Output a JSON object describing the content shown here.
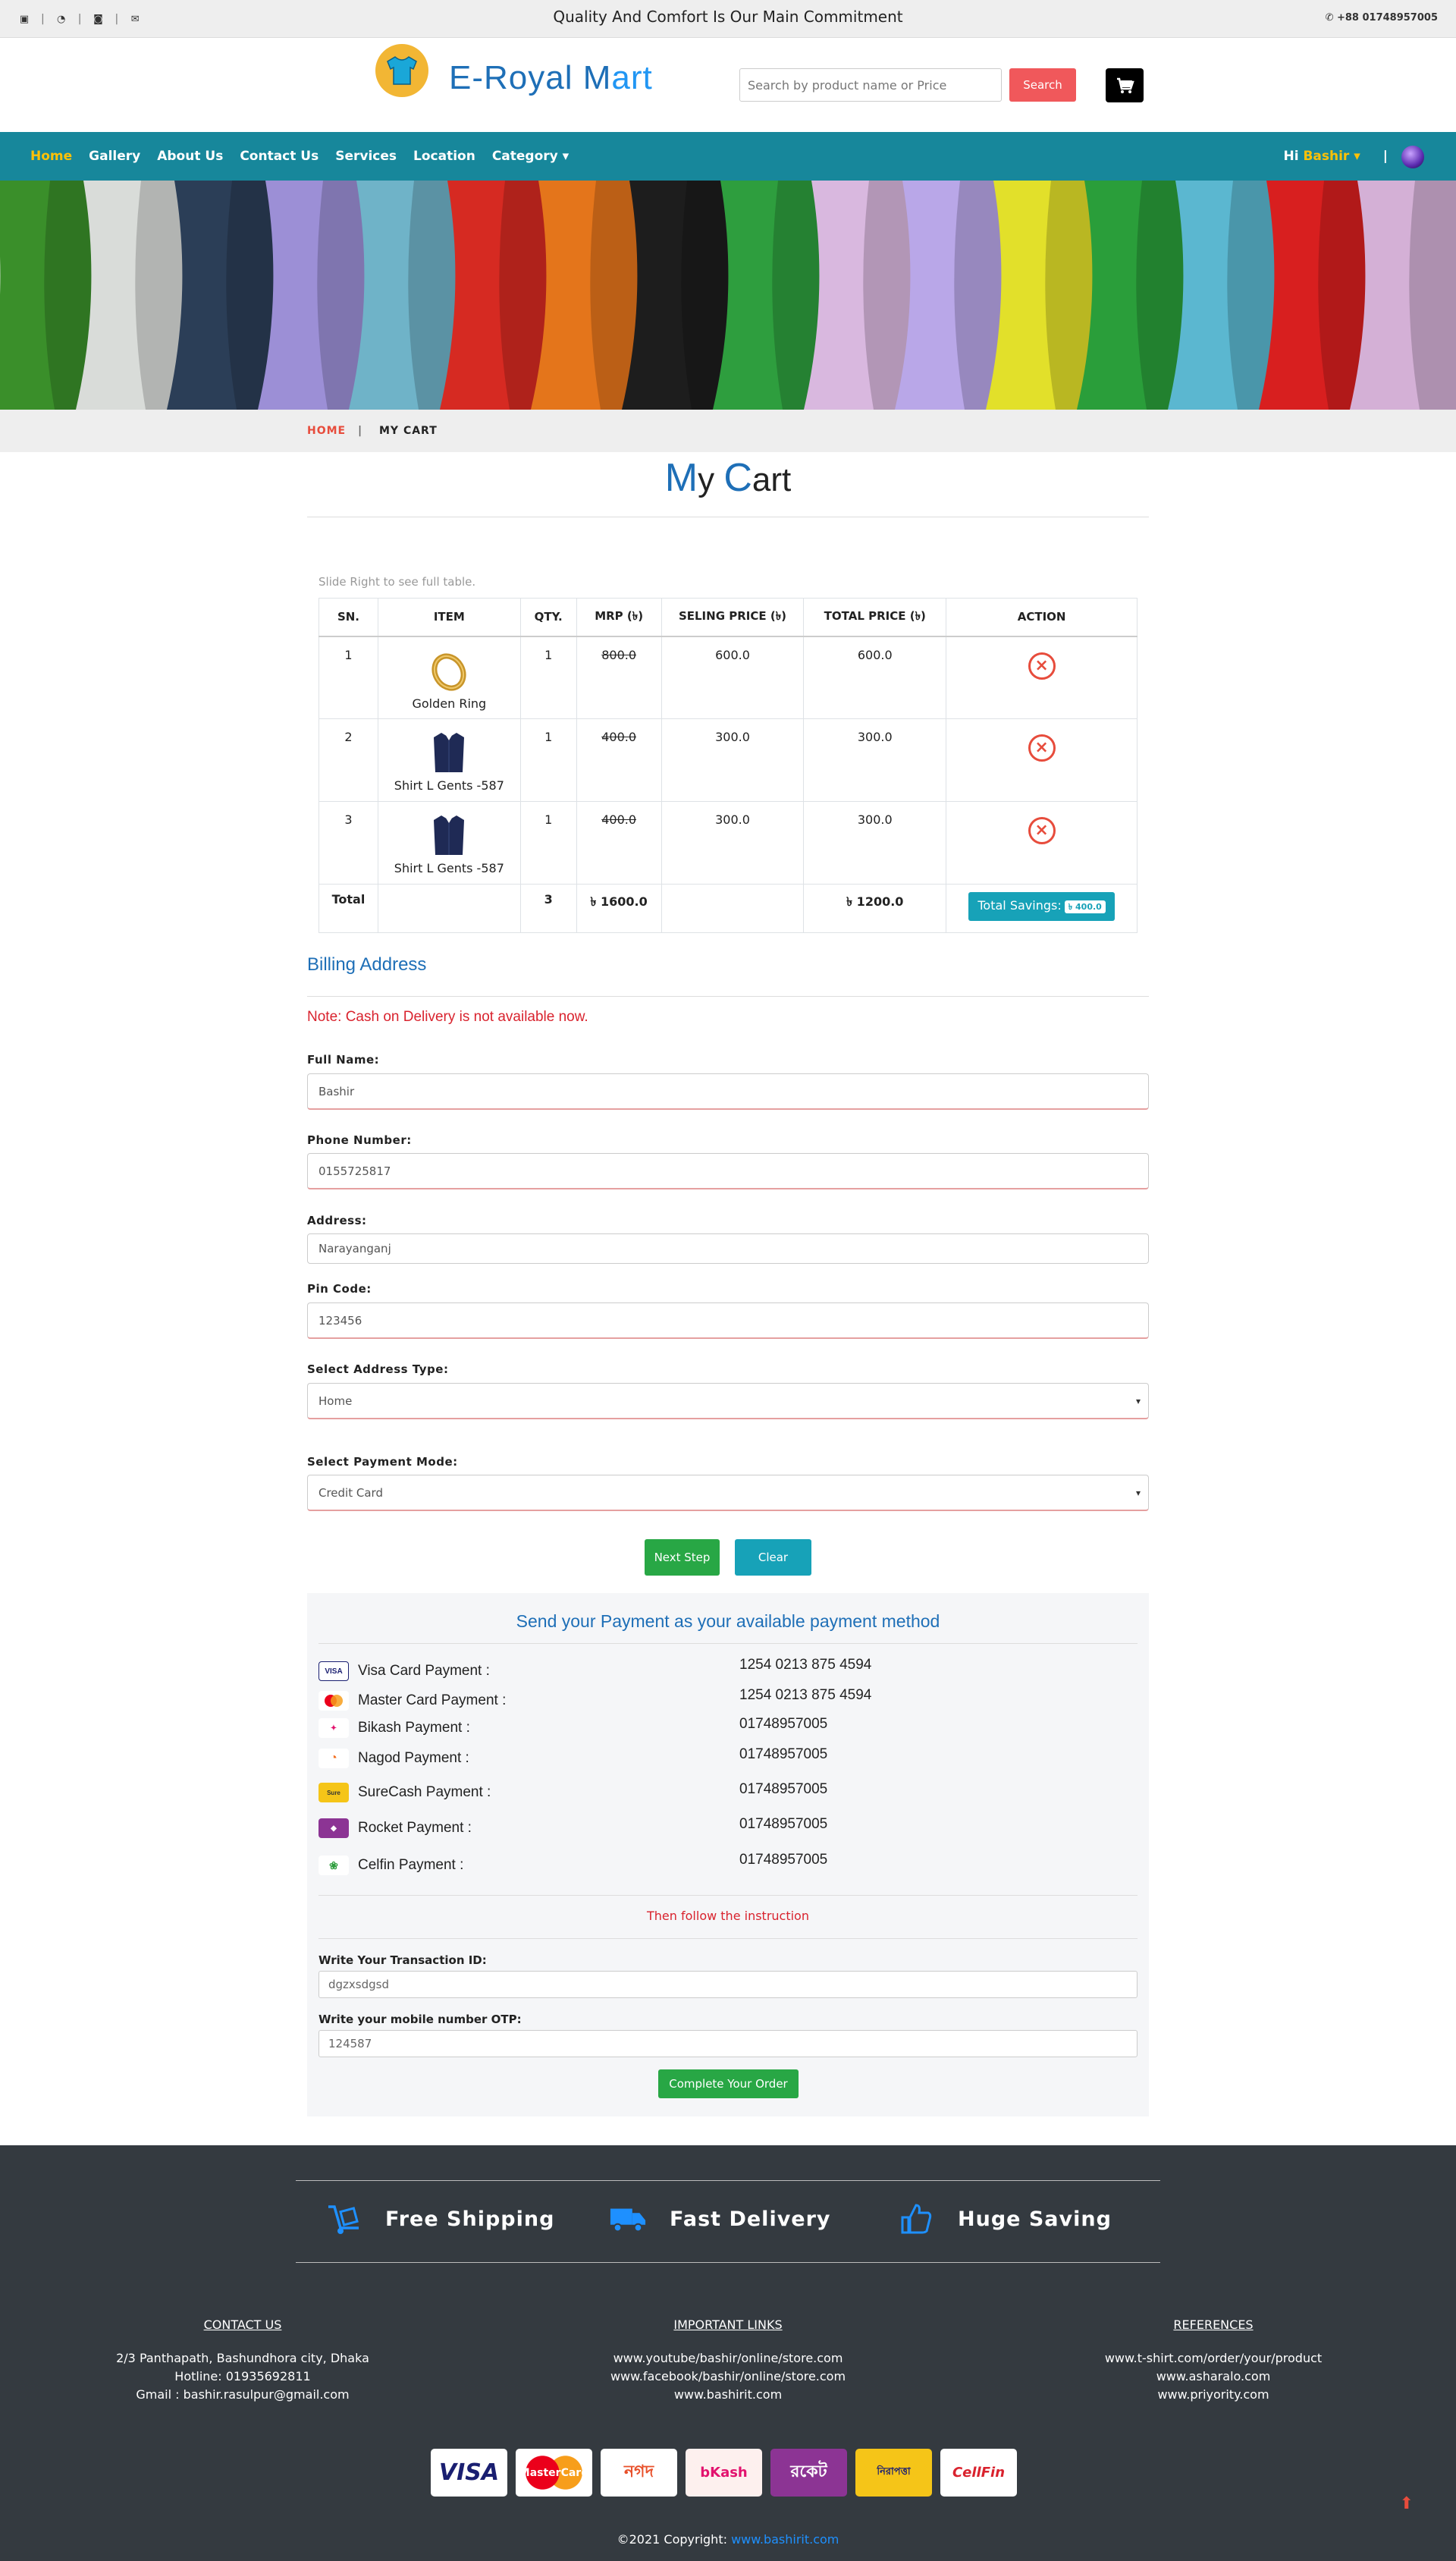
{
  "topbar": {
    "social_icons": [
      "facebook-icon",
      "whatsapp-icon",
      "instagram-icon",
      "mail-icon"
    ],
    "motto": "Quality And Comfort Is Our Main Commitment",
    "phone": "+88 01748957005"
  },
  "header": {
    "brand_a": "E-Royal M",
    "brand_b": "art",
    "search_placeholder": "Search by product name or Price",
    "search_button": "Search"
  },
  "nav": {
    "links": [
      "Home",
      "Gallery",
      "About Us",
      "Contact Us",
      "Services",
      "Location",
      "Category ▾"
    ],
    "greeting": "Hi",
    "user_name": "Bashir ▾",
    "divider": "|"
  },
  "breadcrumb": {
    "home": "HOME",
    "sep": "|",
    "current": "MY CART"
  },
  "page_title": {
    "c1": "M",
    "t1": "y ",
    "c2": "C",
    "t2": "art"
  },
  "cart": {
    "slide_note": "Slide Right to see full table.",
    "headers": [
      "SN.",
      "ITEM",
      "QTY.",
      "MRP (৳)",
      "SELING PRICE (৳)",
      "TOTAL PRICE (৳)",
      "ACTION"
    ],
    "rows": [
      {
        "sn": "1",
        "item": "Golden Ring",
        "qty": "1",
        "mrp": "800.0",
        "price": "600.0",
        "total": "600.0"
      },
      {
        "sn": "2",
        "item": "Shirt L Gents -587",
        "qty": "1",
        "mrp": "400.0",
        "price": "300.0",
        "total": "300.0"
      },
      {
        "sn": "3",
        "item": "Shirt L Gents -587",
        "qty": "1",
        "mrp": "400.0",
        "price": "300.0",
        "total": "300.0"
      }
    ],
    "total": {
      "label": "Total",
      "qty": "3",
      "mrp": "৳ 1600.0",
      "total": "৳ 1200.0",
      "savings_label": "Total Savings:",
      "savings": "৳ 400.0"
    }
  },
  "billing": {
    "title": "Billing Address",
    "note": "Note: Cash on Delivery is not available now.",
    "full_name_label": "Full Name:",
    "full_name": "Bashir",
    "phone_label": "Phone Number:",
    "phone": "0155725817",
    "address_label": "Address:",
    "address": "Narayanganj",
    "pin_label": "Pin Code:",
    "pin": "123456",
    "address_type_label": "Select Address Type:",
    "address_type": "Home",
    "payment_mode_label": "Select Payment Mode:",
    "payment_mode": "Credit Card",
    "next_button": "Next Step",
    "clear_button": "Clear"
  },
  "payment": {
    "title": "Send your Payment as your available payment method",
    "methods": [
      {
        "label": "Visa Card Payment :",
        "number": "1254 0213 875 4594",
        "color": "#1a1f71"
      },
      {
        "label": "Master Card Payment :",
        "number": "1254 0213 875 4594",
        "color": "#eb001b"
      },
      {
        "label": "Bikash Payment :",
        "number": "01748957005",
        "color": "#e2136e"
      },
      {
        "label": "Nagod Payment :",
        "number": "01748957005",
        "color": "#f37021"
      },
      {
        "label": "SureCash Payment :",
        "number": "01748957005",
        "color": "#f5c518"
      },
      {
        "label": "Rocket Payment :",
        "number": "01748957005",
        "color": "#8c3494"
      },
      {
        "label": "Celfin Payment :",
        "number": "01748957005",
        "color": "#2e9e3e"
      }
    ],
    "instruction": "Then follow the instruction",
    "txn_label": "Write Your Transaction ID:",
    "txn_value": "dgzxsdgsd",
    "otp_label": "Write your mobile number OTP:",
    "otp_value": "124587",
    "complete_button": "Complete Your Order"
  },
  "footer": {
    "features": [
      "Free Shipping",
      "Fast Delivery",
      "Huge Saving"
    ],
    "contact": {
      "head": "CONTACT US",
      "l1": "2/3 Panthapath, Bashundhora city, Dhaka",
      "l2": "Hotline: 01935692811",
      "l3": "Gmail : bashir.rasulpur@gmail.com"
    },
    "links": {
      "head": "IMPORTANT LINKS",
      "l1": "www.youtube/bashir/online/store.com",
      "l2": "www.facebook/bashir/online/store.com",
      "l3": "www.bashirit.com"
    },
    "refs": {
      "head": "REFERENCES",
      "l1": "www.t-shirt.com/order/your/product",
      "l2": "www.asharalo.com",
      "l3": "www.priyority.com"
    },
    "pay_logos": [
      "VISA",
      "MasterCard",
      "নগদ",
      "bKash",
      "রকেট",
      "নিরাপত্তা",
      "CellFin"
    ],
    "copyright": "©2021 Copyright:",
    "copyright_link": "www.bashirit.com"
  },
  "colors": {
    "accent": "#1e6fb7",
    "nav": "#17879b",
    "search_btn": "#f0585b",
    "danger": "#d9232e",
    "success": "#28a745",
    "info": "#17a2b8",
    "footer": "#343a40"
  }
}
